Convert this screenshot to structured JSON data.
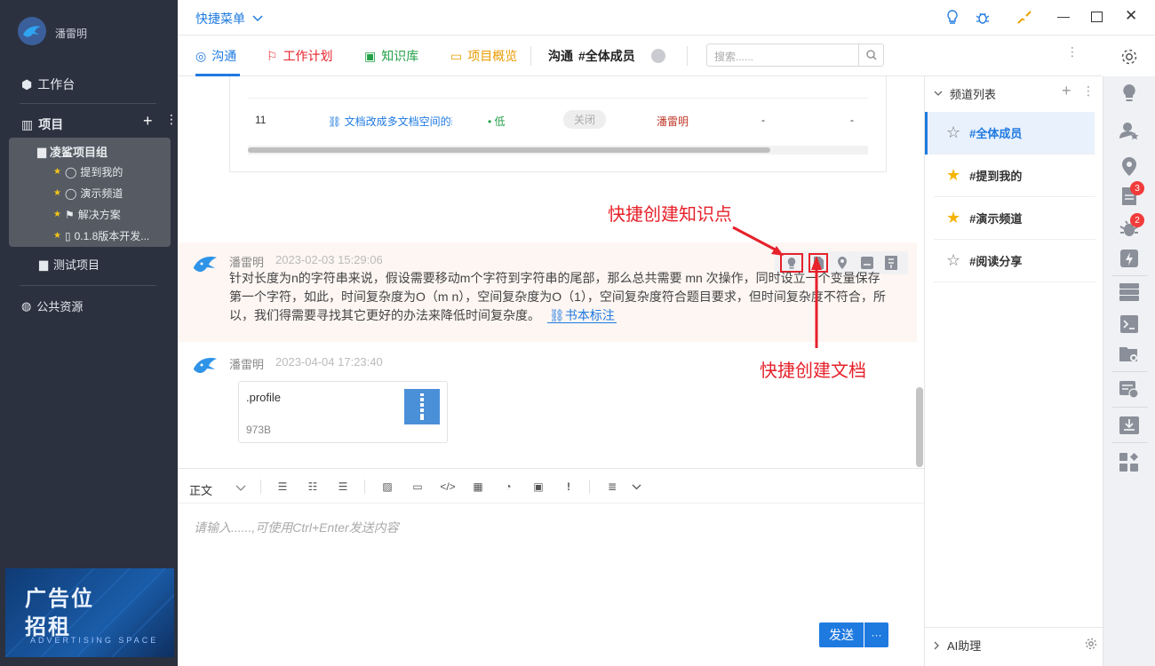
{
  "user": {
    "name": "潘雷明"
  },
  "sidebar": {
    "workbench": "工作台",
    "projects": "项目",
    "group": "凌鲨项目组",
    "group_items": [
      "提到我的",
      "演示频道",
      "解决方案",
      "0.1.8版本开发..."
    ],
    "test_project": "测试项目",
    "public": "公共资源"
  },
  "ad": {
    "line1": "广告位",
    "line2": "招租",
    "line3": "ADVERTISING SPACE"
  },
  "topbar": {
    "quick_menu": "快捷菜单"
  },
  "tabs": [
    "沟通",
    "工作计划",
    "知识库",
    "项目概览"
  ],
  "channel_header": {
    "prefix": "沟通",
    "channel": "#全体成员"
  },
  "search": {
    "placeholder": "搜索......"
  },
  "table_row": {
    "id": "11",
    "title": "文档改成多文档空间的新",
    "priority": "低",
    "status": "关闭",
    "owner": "潘雷明",
    "c1": "-",
    "c2": "-"
  },
  "annotations": {
    "knowledge": "快捷创建知识点",
    "doc": "快捷创建文档"
  },
  "messages": [
    {
      "author": "潘雷明",
      "time": "2023-02-03 15:29:06",
      "text": "针对长度为n的字符串来说，假设需要移动m个字符到字符串的尾部，那么总共需要 mn 次操作，同时设立一个变量保存第一个字符，如此，时间复杂度为O（m n），空间复杂度为O（1），空间复杂度符合题目要求，但时间复杂度不符合，所以，我们得需要寻找其它更好的办法来降低时间复杂度。",
      "link": "书本标注"
    },
    {
      "author": "潘雷明",
      "time": "2023-04-04 17:23:40",
      "file_name": ".profile",
      "file_size": "973B"
    }
  ],
  "editor": {
    "style": "正文",
    "placeholder": "请输入......,可使用Ctrl+Enter发送内容",
    "send": "发送",
    "more": "···"
  },
  "channels": {
    "title": "频道列表",
    "items": [
      "#全体成员",
      "#提到我的",
      "#演示频道",
      "#阅读分享"
    ],
    "ai": "AI助理"
  },
  "rail": {
    "badge_doc": "3",
    "badge_bug": "2"
  },
  "colors": {
    "accent": "#1f7ae0",
    "sidebar_bg": "#2b313f",
    "annotation": "#e6212a"
  }
}
